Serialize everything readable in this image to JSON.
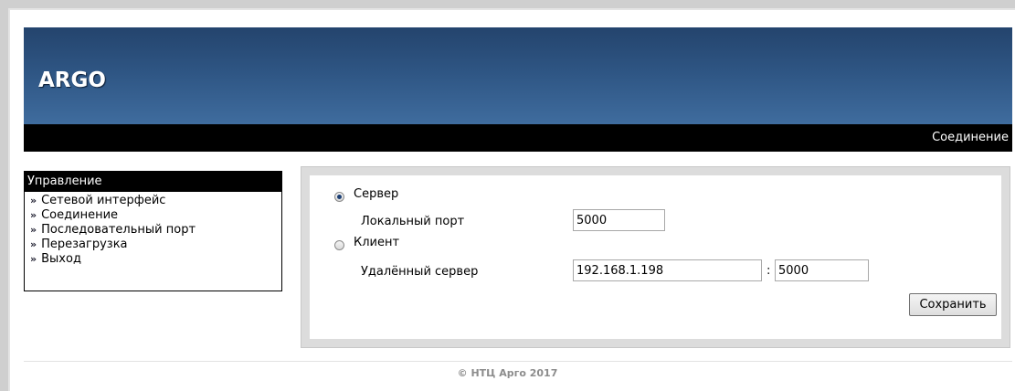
{
  "header": {
    "title": "ARGO"
  },
  "blackbar": {
    "breadcrumb": "Соединение"
  },
  "menu": {
    "heading": "Управление",
    "arrow": "»",
    "items": [
      "Сетевой интерфейс",
      "Соединение",
      "Последовательный порт",
      "Перезагрузка",
      "Выход"
    ]
  },
  "form": {
    "server_label": "Сервер",
    "server_selected": true,
    "local_port_label": "Локальный порт",
    "local_port_value": "5000",
    "client_label": "Клиент",
    "client_selected": false,
    "remote_server_label": "Удалённый сервер",
    "remote_server_value": "192.168.1.198",
    "colon": ":",
    "remote_port_value": "5000",
    "save_label": "Сохранить"
  },
  "footer": {
    "copyright": "© НТЦ Арго 2017"
  }
}
